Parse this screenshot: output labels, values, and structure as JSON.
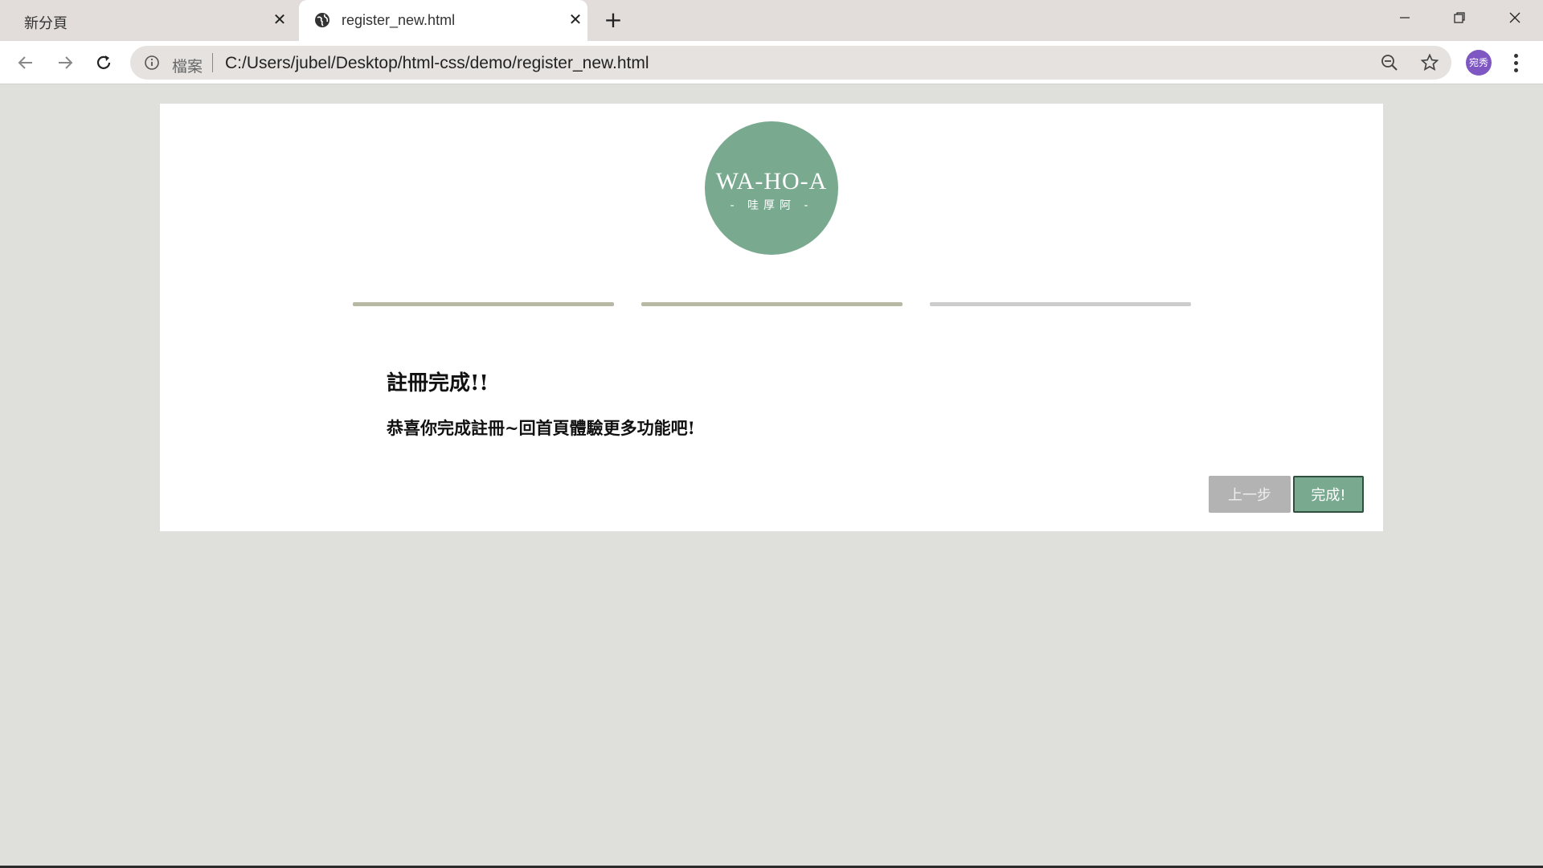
{
  "browser": {
    "tabs": [
      {
        "title": "新分頁",
        "active": false
      },
      {
        "title": "register_new.html",
        "active": true
      }
    ],
    "omnibox": {
      "scheme_label": "檔案",
      "url": "C:/Users/jubel/Desktop/html-css/demo/register_new.html"
    },
    "profile_initials": "宛秀",
    "accent_color": "#7e57c2"
  },
  "page": {
    "logo": {
      "main": "WA-HO-A",
      "sub": "- 哇厚阿 -",
      "color": "#79a98f"
    },
    "progress": {
      "total_steps": 3,
      "completed_steps": 2,
      "completed_color": "#b7b9a5",
      "pending_color": "#cccccc"
    },
    "title": "註冊完成!!",
    "message": "恭喜你完成註冊~回首頁體驗更多功能吧!",
    "buttons": {
      "prev": "上一步",
      "finish": "完成!"
    }
  }
}
